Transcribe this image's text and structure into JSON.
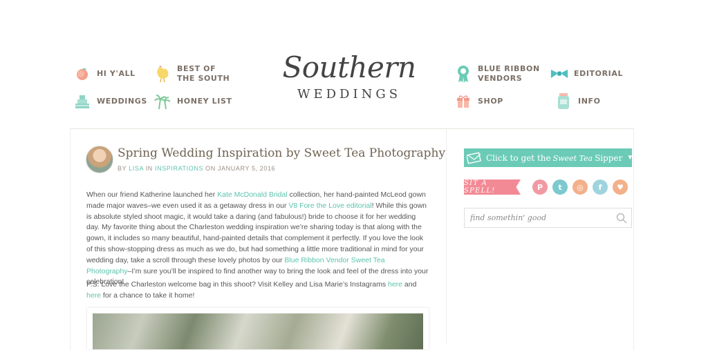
{
  "nav": {
    "left": [
      {
        "label": "HI Y'ALL",
        "icon": "peach-icon"
      },
      {
        "label": "BEST OF THE SOUTH",
        "icon": "chicken-icon"
      },
      {
        "label": "WEDDINGS",
        "icon": "cake-icon"
      },
      {
        "label": "HONEY LIST",
        "icon": "palm-tree-icon"
      }
    ],
    "right": [
      {
        "label": "BLUE RIBBON VENDORS",
        "icon": "ribbon-icon"
      },
      {
        "label": "EDITORIAL",
        "icon": "bowtie-icon"
      },
      {
        "label": "SHOP",
        "icon": "gift-icon"
      },
      {
        "label": "INFO",
        "icon": "mason-jar-icon"
      }
    ]
  },
  "logo": {
    "script": "Southern",
    "sub": "WEDDINGS"
  },
  "post": {
    "title": "Spring Wedding Inspiration by Sweet Tea Photography",
    "byline": {
      "by": "BY",
      "author": "LISA",
      "in": "IN",
      "category": "INSPIRATIONS",
      "on": "ON",
      "date": "JANUARY 5, 2016"
    },
    "p1": {
      "t1": "When our friend Katherine launched her ",
      "l1": "Kate McDonald Bridal",
      "t2": " collection, her hand-painted McLeod gown made major waves–we even used it as a getaway dress in our ",
      "l2": "V8 Fore the Love editorial",
      "t3": "! While this gown is absolute styled shoot magic, it would take a daring (and fabulous!) bride to choose it for her wedding day. My favorite thing about the Charleston wedding inspiration we’re sharing today is that along with the gown, it includes so many beautiful, hand-painted details that complement it perfectly. If you love the look of this show-stopping dress as much as we do, but had something a little more traditional in mind for your wedding day, take a scroll through these lovely photos by our ",
      "l3": "Blue Ribbon Vendor Sweet Tea Photography",
      "t4": "–I’m sure you’ll be inspired to find another way to bring the look and feel of the dress into your celebration!"
    },
    "p2": {
      "t1": "P.S. Love the Charleston welcome bag in this shoot? Visit Kelley and Lisa Marie’s Instagrams ",
      "l1": "here",
      "t2": " and ",
      "l2": "here",
      "t3": " for a chance to take it home!"
    }
  },
  "sidebar": {
    "sipper": {
      "pre": "Click to get the",
      "script": "Sweet Tea",
      "post": "Sipper"
    },
    "spell": "SIT A SPELL!",
    "social": [
      {
        "icon": "pinterest-icon",
        "glyph": "P",
        "color": "#f29aa3"
      },
      {
        "icon": "twitter-icon",
        "glyph": "t",
        "color": "#7cc9cf"
      },
      {
        "icon": "instagram-icon",
        "glyph": "◎",
        "color": "#f3b08b"
      },
      {
        "icon": "facebook-icon",
        "glyph": "f",
        "color": "#9fd4df"
      },
      {
        "icon": "heart-icon",
        "glyph": "♥",
        "color": "#f3b08b"
      }
    ],
    "search": {
      "placeholder": "find somethin' good"
    }
  },
  "colors": {
    "accent": "#5cc3ad",
    "banner": "#6ccbb7",
    "pink": "#f28a95"
  }
}
